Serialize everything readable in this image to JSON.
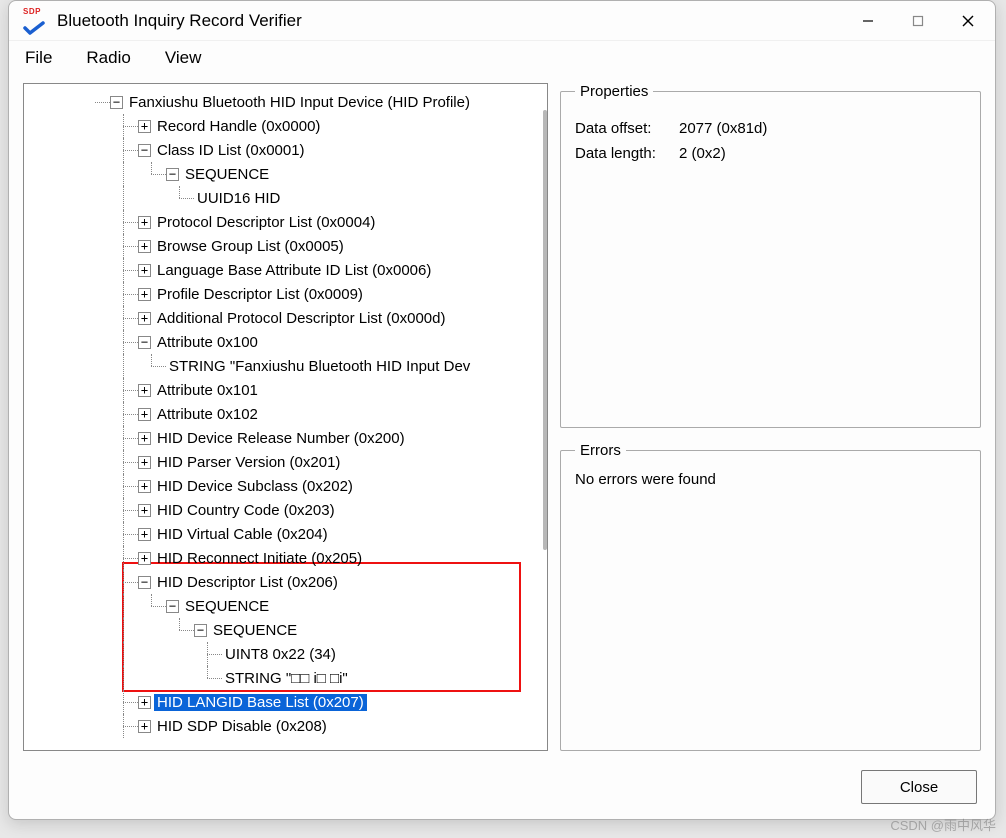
{
  "window": {
    "title": "Bluetooth Inquiry Record Verifier",
    "icon_label": "SDP"
  },
  "menu": {
    "file": "File",
    "radio": "Radio",
    "view": "View"
  },
  "tree": {
    "root": "Fanxiushu Bluetooth HID Input Device (HID Profile)",
    "record_handle": "Record Handle (0x0000)",
    "class_id_list": "Class ID List (0x0001)",
    "class_seq": "SEQUENCE",
    "class_uuid": "UUID16 HID",
    "protocol_desc": "Protocol Descriptor List (0x0004)",
    "browse_group": "Browse Group List (0x0005)",
    "lang_base": "Language Base Attribute ID List (0x0006)",
    "profile_desc": "Profile Descriptor List (0x0009)",
    "add_protocol": "Additional Protocol Descriptor List (0x000d)",
    "attr_100": "Attribute 0x100",
    "attr_100_string": "STRING \"Fanxiushu Bluetooth HID Input Dev",
    "attr_101": "Attribute 0x101",
    "attr_102": "Attribute 0x102",
    "hid_release": "HID Device Release Number (0x200)",
    "hid_parser": "HID Parser Version (0x201)",
    "hid_subclass": "HID Device Subclass (0x202)",
    "hid_country": "HID Country Code (0x203)",
    "hid_vcable": "HID Virtual Cable (0x204)",
    "hid_reconnect": "HID Reconnect Initiate (0x205)",
    "hid_desc_list": "HID Descriptor List (0x206)",
    "hid_desc_seq1": "SEQUENCE",
    "hid_desc_seq2": "SEQUENCE",
    "hid_desc_uint": "UINT8 0x22 (34)",
    "hid_desc_string": "STRING \"□□ i□ □i\"",
    "hid_langid": "HID LANGID Base List (0x207)",
    "hid_sdp_disable": "HID SDP Disable (0x208)"
  },
  "expander": {
    "plus": "+",
    "minus": "−"
  },
  "properties": {
    "legend": "Properties",
    "offset_label": "Data offset:",
    "offset_value": "2077 (0x81d)",
    "length_label": "Data length:",
    "length_value": "2 (0x2)"
  },
  "errors": {
    "legend": "Errors",
    "text": "No errors were found"
  },
  "footer": {
    "close": "Close"
  },
  "watermark": "CSDN @雨中风华"
}
